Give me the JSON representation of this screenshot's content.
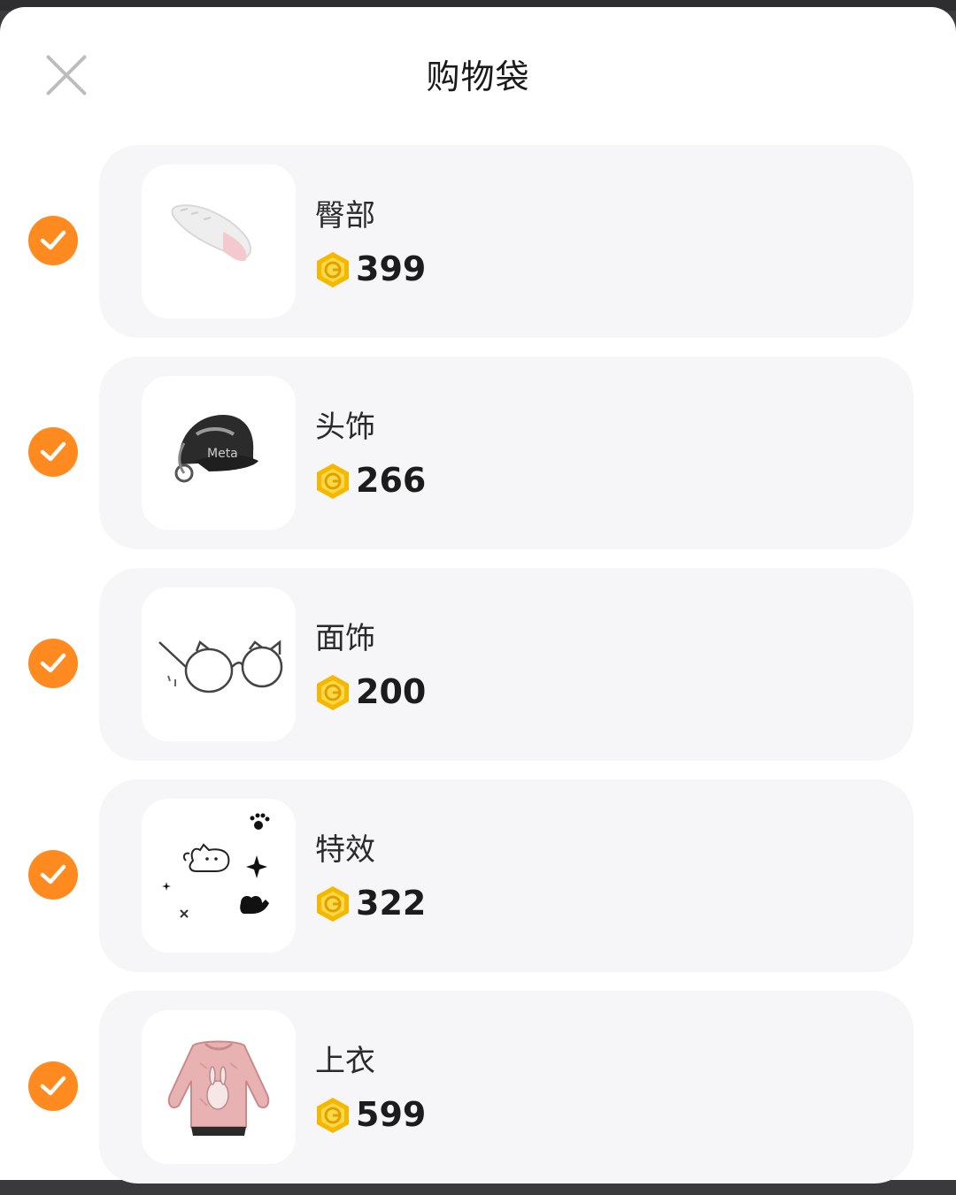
{
  "header": {
    "title": "购物袋"
  },
  "items": [
    {
      "name": "臀部",
      "price": "399",
      "icon": "tail-icon",
      "selected": true
    },
    {
      "name": "头饰",
      "price": "266",
      "icon": "cap-icon",
      "selected": true
    },
    {
      "name": "面饰",
      "price": "200",
      "icon": "glasses-icon",
      "selected": true
    },
    {
      "name": "特效",
      "price": "322",
      "icon": "cat-effect-icon",
      "selected": true
    },
    {
      "name": "上衣",
      "price": "599",
      "icon": "sweater-icon",
      "selected": true
    }
  ],
  "colors": {
    "accent": "#ff8a1f",
    "coin": "#f5b800",
    "card": "#f6f6f8"
  }
}
